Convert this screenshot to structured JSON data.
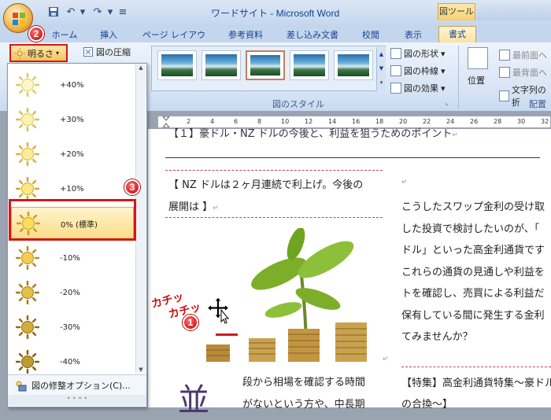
{
  "window": {
    "title": "ワードサイト - Microsoft Word",
    "tool_context": "図ツール"
  },
  "tabs": [
    {
      "label": "ホーム"
    },
    {
      "label": "挿入"
    },
    {
      "label": "ページ レイアウト"
    },
    {
      "label": "参考資料"
    },
    {
      "label": "差し込み文書"
    },
    {
      "label": "校閲"
    },
    {
      "label": "表示"
    },
    {
      "label": "書式"
    }
  ],
  "ribbon": {
    "brightness_label": "明るさ",
    "compress_label": "図の圧縮",
    "picture_styles_group": "図のスタイル",
    "arrange_group": "配置",
    "shape_label": "図の形状",
    "border_label": "図の枠線",
    "effects_label": "図の効果",
    "position_label": "位置",
    "front_label": "最前面へ",
    "back_label": "最背面へ",
    "text_wrap_label": "文字列の折"
  },
  "brightness_menu": {
    "items": [
      {
        "label": "+40%"
      },
      {
        "label": "+30%"
      },
      {
        "label": "+20%"
      },
      {
        "label": "+10%"
      },
      {
        "label": "0% (標準)"
      },
      {
        "label": "-10%"
      },
      {
        "label": "-20%"
      },
      {
        "label": "-30%"
      },
      {
        "label": "-40%"
      }
    ],
    "selected_index": 4,
    "options_label": "図の修整オプション(C)..."
  },
  "steps": [
    "1",
    "2",
    "3"
  ],
  "annotation": {
    "line1": "カチッ",
    "line2": "カチッ"
  },
  "document": {
    "top_line": "【１】豪ドル・NZ ドルの今後と、利益を狙うためのポイント",
    "heading_line1": "【 NZ ドルは２ヶ月連続で利上げ。今後の",
    "heading_line2": "展開は 】",
    "right_lines": [
      "こうしたスワップ金利の受け取",
      "した投資で検討したいのが、「",
      "ドル」といった高金利通貨です",
      "これらの通貨の見通しや利益を",
      "トを確認し、売買による利益だ",
      "保有している間に発生する金利",
      "てみませんか？"
    ],
    "feature_line1": "【特集】高金利通貨特集～豪ドル",
    "feature_line2": "の合換～】",
    "bottom_left_line1": "段から相場を確認する時間",
    "bottom_left_line2": "がないという方や、中長期",
    "dropcap": "並"
  },
  "ruler_numbers": [
    "2",
    "4",
    "6",
    "8",
    "10",
    "12",
    "14",
    "16",
    "18",
    "20",
    "22",
    "24",
    "26",
    "28",
    "30",
    "32"
  ]
}
